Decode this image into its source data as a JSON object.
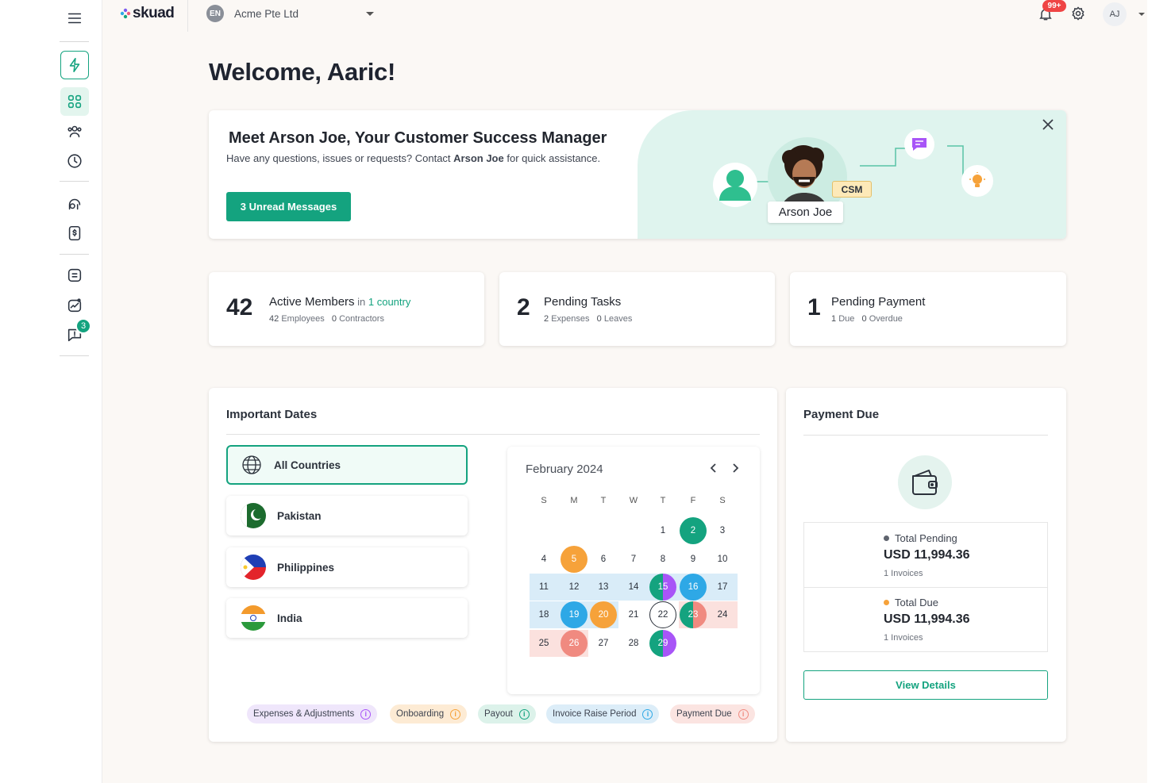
{
  "header": {
    "logo": "skuad",
    "company_badge": "EN",
    "company_name": "Acme Pte Ltd",
    "notifications_badge": "99+",
    "user_initials": "AJ"
  },
  "sidebar": {
    "messages_badge": "3"
  },
  "welcome": "Welcome, Aaric!",
  "csm_banner": {
    "title": "Meet Arson Joe, Your Customer Success Manager",
    "text_before": "Have any questions, issues or requests? Contact ",
    "text_name": "Arson Joe",
    "text_after": " for quick assistance.",
    "button": "3 Unread Messages",
    "csm_tag": "CSM",
    "csm_name": "Arson Joe"
  },
  "stats": [
    {
      "number": "42",
      "title": "Active Members",
      "title_in": " in ",
      "title_link": "1 country",
      "sub_a_num": "42",
      "sub_a_label": "Employees",
      "sub_b_num": "0",
      "sub_b_label": "Contractors"
    },
    {
      "number": "2",
      "title": "Pending Tasks",
      "sub_a_num": "2",
      "sub_a_label": "Expenses",
      "sub_b_num": "0",
      "sub_b_label": "Leaves"
    },
    {
      "number": "1",
      "title": "Pending Payment",
      "sub_a_num": "1",
      "sub_a_label": "Due",
      "sub_b_num": "0",
      "sub_b_label": "Overdue"
    }
  ],
  "important_dates": {
    "title": "Important Dates",
    "countries": [
      "All Countries",
      "Pakistan",
      "Philippines",
      "India"
    ],
    "calendar": {
      "month": "February 2024",
      "weekdays": [
        "S",
        "M",
        "T",
        "W",
        "T",
        "F",
        "S"
      ],
      "days": [
        "1",
        "2",
        "3",
        "4",
        "5",
        "6",
        "7",
        "8",
        "9",
        "10",
        "11",
        "12",
        "13",
        "14",
        "15",
        "16",
        "17",
        "18",
        "19",
        "20",
        "21",
        "22",
        "23",
        "24",
        "25",
        "26",
        "27",
        "28",
        "29"
      ]
    },
    "legend": [
      "Expenses & Adjustments",
      "Onboarding",
      "Payout",
      "Invoice Raise Period",
      "Payment Due"
    ]
  },
  "payment_due": {
    "title": "Payment Due",
    "pending_label": "Total Pending",
    "pending_amount": "USD 11,994.36",
    "pending_invoices": "1 Invoices",
    "due_label": "Total Due",
    "due_amount": "USD 11,994.36",
    "due_invoices": "1 Invoices",
    "button": "View Details"
  },
  "colors": {
    "brand_teal": "#14a37f",
    "mint_bg": "#e2f5ef",
    "orange": "#f6a23a",
    "blue": "#2ea8e6",
    "purple": "#a855f7",
    "salmon": "#f08a80",
    "notif_red": "#ef4444"
  }
}
